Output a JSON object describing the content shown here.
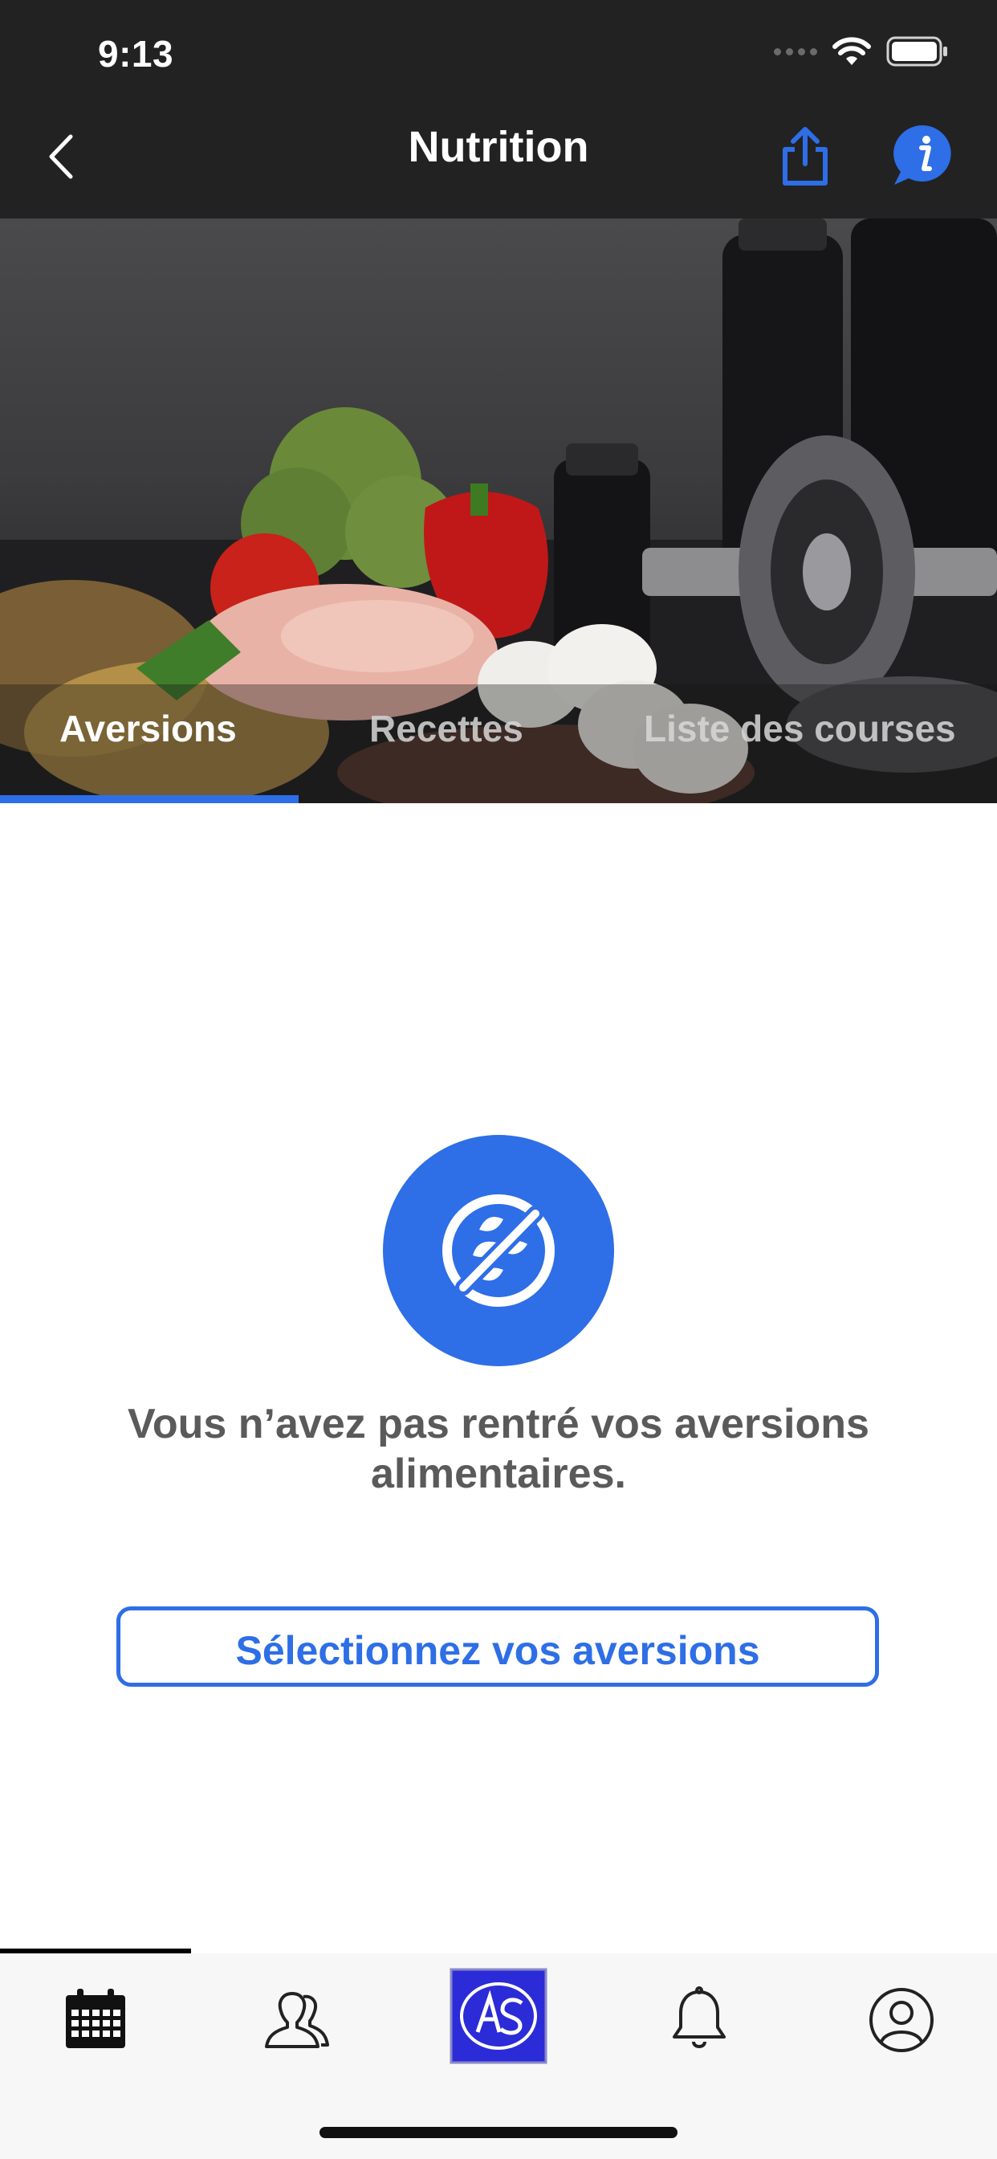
{
  "status_bar": {
    "time": "9:13",
    "icons": [
      "signal-dots",
      "wifi-icon",
      "battery-icon"
    ]
  },
  "nav": {
    "title": "Nutrition",
    "icons": [
      "back-chevron-icon",
      "share-icon",
      "info-icon"
    ],
    "accent": "#2e6ee6"
  },
  "hero": {
    "image": "food-and-dumbbell-photo"
  },
  "tabs": [
    {
      "label": "Aversions",
      "active": true
    },
    {
      "label": "Recettes",
      "active": false
    },
    {
      "label": "Liste des courses",
      "active": false
    }
  ],
  "empty_state": {
    "icon": "no-grain-icon",
    "message_line1": "Vous n’avez pas rentré vos aversions",
    "message_line2": "alimentaires.",
    "button_label": "Sélectionnez vos aversions"
  },
  "tabbar": {
    "items": [
      {
        "icon": "calendar-icon",
        "active": true
      },
      {
        "icon": "users-icon",
        "active": false
      },
      {
        "icon": "app-logo",
        "active": false
      },
      {
        "icon": "bell-icon",
        "active": false
      },
      {
        "icon": "profile-icon",
        "active": false
      }
    ]
  },
  "colors": {
    "accent": "#2e6ee6",
    "topbar": "#222223",
    "text_gray": "#5a5a5a"
  }
}
